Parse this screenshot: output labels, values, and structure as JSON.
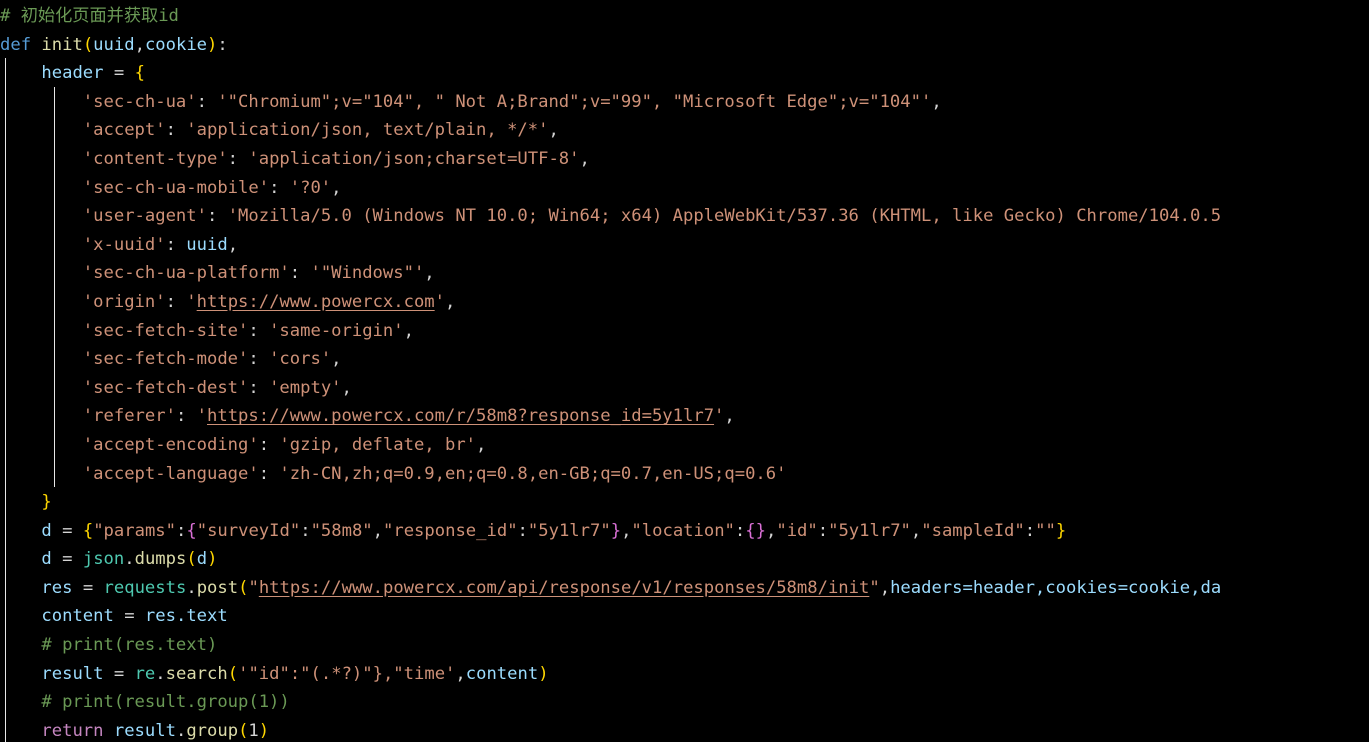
{
  "editor": {
    "language": "python",
    "theme": "dark-plus-black",
    "background_color": "#000000",
    "font_size_px": 17,
    "line_height_px": 28.6,
    "line_count": 26,
    "indent_guides_visible": true,
    "horizontally_clipped": true
  },
  "colors": {
    "background": "#000000",
    "default_text": "#d4d4d4",
    "comment": "#6a9955",
    "keyword": "#569cd6",
    "control_keyword": "#c586c0",
    "function": "#dcdcaa",
    "variable": "#9cdcfe",
    "class_module": "#4ec9b0",
    "string": "#ce9178",
    "bracket_level_1": "#ffd700",
    "bracket_level_2": "#da70d6",
    "bracket_level_3": "#179fff",
    "indent_guide": "#e8e8e8"
  },
  "code": {
    "lines": [
      {
        "n": 1,
        "text": "# 初始化页面并获取id"
      },
      {
        "n": 2,
        "text": "def init(uuid,cookie):"
      },
      {
        "n": 3,
        "text": "    header = {"
      },
      {
        "n": 4,
        "text": "        'sec-ch-ua': '\"Chromium\";v=\"104\", \" Not A;Brand\";v=\"99\", \"Microsoft Edge\";v=\"104\"',"
      },
      {
        "n": 5,
        "text": "        'accept': 'application/json, text/plain, */*',"
      },
      {
        "n": 6,
        "text": "        'content-type': 'application/json;charset=UTF-8',"
      },
      {
        "n": 7,
        "text": "        'sec-ch-ua-mobile': '?0',"
      },
      {
        "n": 8,
        "text": "        'user-agent': 'Mozilla/5.0 (Windows NT 10.0; Win64; x64) AppleWebKit/537.36 (KHTML, like Gecko) Chrome/104.0.5"
      },
      {
        "n": 9,
        "text": "        'x-uuid': uuid,"
      },
      {
        "n": 10,
        "text": "        'sec-ch-ua-platform': '\"Windows\"',"
      },
      {
        "n": 11,
        "text": "        'origin': 'https://www.powercx.com',"
      },
      {
        "n": 12,
        "text": "        'sec-fetch-site': 'same-origin',"
      },
      {
        "n": 13,
        "text": "        'sec-fetch-mode': 'cors',"
      },
      {
        "n": 14,
        "text": "        'sec-fetch-dest': 'empty',"
      },
      {
        "n": 15,
        "text": "        'referer': 'https://www.powercx.com/r/58m8?response_id=5y1lr7',"
      },
      {
        "n": 16,
        "text": "        'accept-encoding': 'gzip, deflate, br',"
      },
      {
        "n": 17,
        "text": "        'accept-language': 'zh-CN,zh;q=0.9,en;q=0.8,en-GB;q=0.7,en-US;q=0.6'"
      },
      {
        "n": 18,
        "text": "    }"
      },
      {
        "n": 19,
        "text": "    d = {\"params\":{\"surveyId\":\"58m8\",\"response_id\":\"5y1lr7\"},\"location\":{},\"id\":\"5y1lr7\",\"sampleId\":\"\"}"
      },
      {
        "n": 20,
        "text": "    d = json.dumps(d)"
      },
      {
        "n": 21,
        "text": "    res = requests.post(\"https://www.powercx.com/api/response/v1/responses/58m8/init\",headers=header,cookies=cookie,da"
      },
      {
        "n": 22,
        "text": "    content = res.text"
      },
      {
        "n": 23,
        "text": "    # print(res.text)"
      },
      {
        "n": 24,
        "text": "    result = re.search('\"id\":\"(.*?)\"},\"time',content)"
      },
      {
        "n": 25,
        "text": "    # print(result.group(1))"
      },
      {
        "n": 26,
        "text": "    return result.group(1)"
      }
    ],
    "tokens": {
      "line1": {
        "hash": "#",
        "comment_text": " 初始化页面并获取id"
      },
      "line2": {
        "keyword": "def",
        "fn_name": "init",
        "param1": "uuid",
        "param2": "cookie"
      },
      "line3": {
        "var": "header",
        "op": "=",
        "brace": "{"
      },
      "line4": {
        "key": "'sec-ch-ua'",
        "value": "'\"Chromium\";v=\"104\", \" Not A;Brand\";v=\"99\", \"Microsoft Edge\";v=\"104\"'"
      },
      "line5": {
        "key": "'accept'",
        "value": "'application/json, text/plain, */*'"
      },
      "line6": {
        "key": "'content-type'",
        "value": "'application/json;charset=UTF-8'"
      },
      "line7": {
        "key": "'sec-ch-ua-mobile'",
        "value": "'?0'"
      },
      "line8": {
        "key": "'user-agent'",
        "value": "'Mozilla/5.0 (Windows NT 10.0; Win64; x64) AppleWebKit/537.36 (KHTML, like Gecko) Chrome/104.0.5",
        "clipped": true
      },
      "line9": {
        "key": "'x-uuid'",
        "value": "uuid"
      },
      "line10": {
        "key": "'sec-ch-ua-platform'",
        "value": "'\"Windows\"'"
      },
      "line11": {
        "key": "'origin'",
        "url": "https://www.powercx.com"
      },
      "line12": {
        "key": "'sec-fetch-site'",
        "value": "'same-origin'"
      },
      "line13": {
        "key": "'sec-fetch-mode'",
        "value": "'cors'"
      },
      "line14": {
        "key": "'sec-fetch-dest'",
        "value": "'empty'"
      },
      "line15": {
        "key": "'referer'",
        "url": "https://www.powercx.com/r/58m8?response_id=5y1lr7"
      },
      "line16": {
        "key": "'accept-encoding'",
        "value": "'gzip, deflate, br'"
      },
      "line17": {
        "key": "'accept-language'",
        "value": "'zh-CN,zh;q=0.9,en;q=0.8,en-GB;q=0.7,en-US;q=0.6'"
      },
      "line19": {
        "var": "d",
        "json_payload": "{\"params\":{\"surveyId\":\"58m8\",\"response_id\":\"5y1lr7\"},\"location\":{},\"id\":\"5y1lr7\",\"sampleId\":\"\"}"
      },
      "line20": {
        "var": "d",
        "module": "json",
        "fn": "dumps",
        "arg": "d"
      },
      "line21": {
        "var": "res",
        "module": "requests",
        "fn": "post",
        "url": "https://www.powercx.com/api/response/v1/responses/58m8/init",
        "kwargs": "headers=header,cookies=cookie,da",
        "clipped": true
      },
      "line22": {
        "var": "content",
        "value": "res.text"
      },
      "line23": {
        "comment": "# print(res.text)"
      },
      "line24": {
        "var": "result",
        "module": "re",
        "fn": "search",
        "pattern": "'\"id\":\"(.*?)\"},\"time'",
        "arg": "content"
      },
      "line25": {
        "comment": "# print(result.group(1))"
      },
      "line26": {
        "keyword": "return",
        "value": "result.group(1)"
      }
    }
  }
}
